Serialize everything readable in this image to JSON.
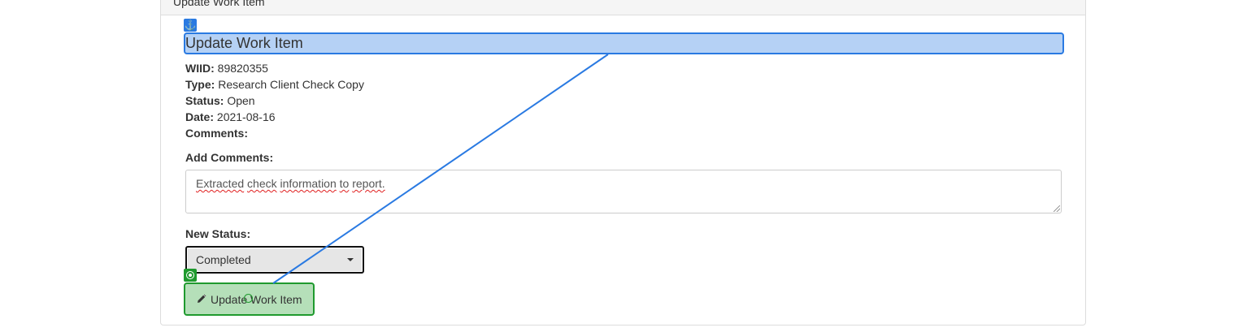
{
  "panel": {
    "heading_title": "Update Work Item"
  },
  "page": {
    "title": "Update Work Item"
  },
  "work_item": {
    "wiid_label": "WIID:",
    "wiid_value": "89820355",
    "type_label": "Type:",
    "type_value": "Research Client Check Copy",
    "status_label": "Status:",
    "status_value": "Open",
    "date_label": "Date:",
    "date_value": "2021-08-16",
    "comments_label": "Comments:"
  },
  "form": {
    "add_comments_label": "Add Comments:",
    "comment_words": [
      "Extracted",
      "check",
      "information",
      "to",
      "report."
    ],
    "new_status_label": "New Status:",
    "new_status_selected": "Completed",
    "submit_label": "Update Work Item"
  },
  "overlay": {
    "anchor_icon": "anchor-icon",
    "target_icon": "target-icon",
    "move_icon": "move-icon",
    "accent_blue": "#2a7ae2",
    "accent_green": "#1f9a2e"
  }
}
